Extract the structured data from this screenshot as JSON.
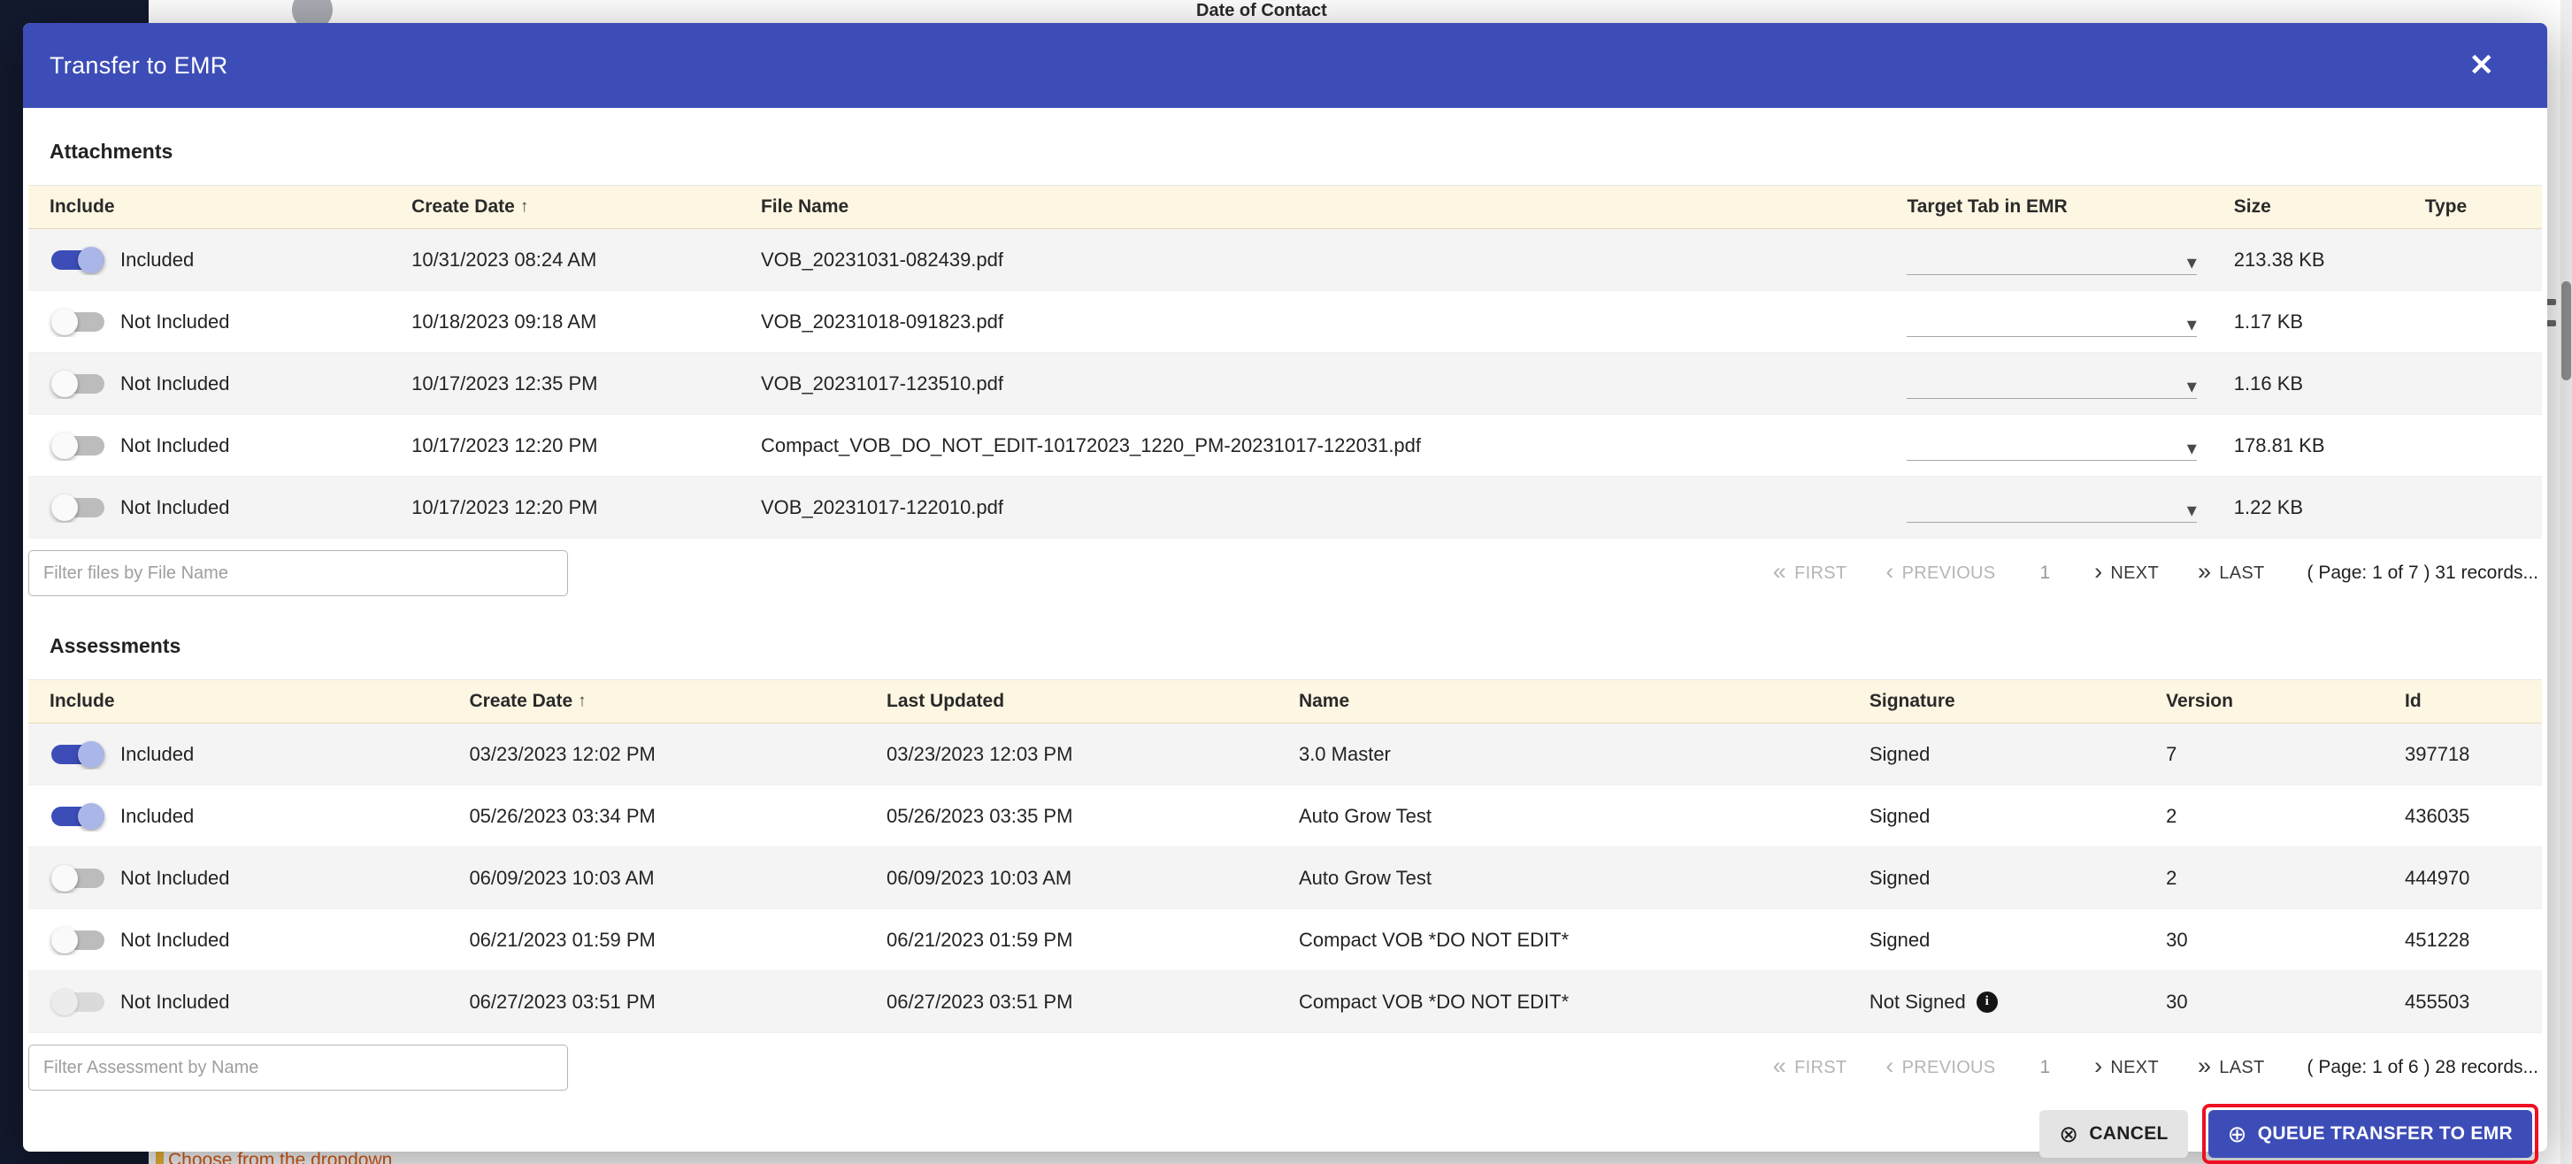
{
  "colors": {
    "accent": "#3d4db7",
    "table-header-bg": "#fdf6e2",
    "row-alt": "#f4f4f4",
    "annotation": "#ee1020",
    "hint-orange": "#e05a14",
    "sidebar": "#131a2e"
  },
  "icons": {
    "close": "✕",
    "caret": "▾",
    "info": "i",
    "cancel_circle": "⊗",
    "plus_circle": "⊕"
  },
  "modal": {
    "title": "Transfer to EMR"
  },
  "attachments": {
    "section_label": "Attachments",
    "columns": {
      "include": "Include",
      "create_date": "Create Date",
      "sort_arrow": "↑",
      "file_name": "File Name",
      "target_tab": "Target Tab in EMR",
      "size": "Size",
      "type": "Type"
    },
    "rows": [
      {
        "include_label": "Included",
        "create_date": "10/31/2023 08:24 AM",
        "file_name": "VOB_20231031-082439.pdf",
        "size": "213.38 KB"
      },
      {
        "include_label": "Not Included",
        "create_date": "10/18/2023 09:18 AM",
        "file_name": "VOB_20231018-091823.pdf",
        "size": "1.17 KB"
      },
      {
        "include_label": "Not Included",
        "create_date": "10/17/2023 12:35 PM",
        "file_name": "VOB_20231017-123510.pdf",
        "size": "1.16 KB"
      },
      {
        "include_label": "Not Included",
        "create_date": "10/17/2023 12:20 PM",
        "file_name": "Compact_VOB_DO_NOT_EDIT-10172023_1220_PM-20231017-122031.pdf",
        "size": "178.81 KB"
      },
      {
        "include_label": "Not Included",
        "create_date": "10/17/2023 12:20 PM",
        "file_name": "VOB_20231017-122010.pdf",
        "size": "1.22 KB"
      }
    ],
    "filter_placeholder": "Filter files by File Name",
    "pagination": {
      "first_icon": "«",
      "first": "FIRST",
      "prev_icon": "‹",
      "previous": "PREVIOUS",
      "page": "1",
      "next_icon": "›",
      "next": "NEXT",
      "last_icon": "»",
      "last": "LAST",
      "summary": "( Page: 1 of 7 ) 31 records..."
    }
  },
  "assessments": {
    "section_label": "Assessments",
    "columns": {
      "include": "Include",
      "create_date": "Create Date",
      "sort_arrow": "↑",
      "last_updated": "Last Updated",
      "name": "Name",
      "signature": "Signature",
      "version": "Version",
      "id": "Id"
    },
    "rows": [
      {
        "include_label": "Included",
        "create_date": "03/23/2023 12:02 PM",
        "last_updated": "03/23/2023 12:03 PM",
        "name": "3.0 Master",
        "signature": "Signed",
        "version": "7",
        "id": "397718"
      },
      {
        "include_label": "Included",
        "create_date": "05/26/2023 03:34 PM",
        "last_updated": "05/26/2023 03:35 PM",
        "name": "Auto Grow Test",
        "signature": "Signed",
        "version": "2",
        "id": "436035"
      },
      {
        "include_label": "Not Included",
        "create_date": "06/09/2023 10:03 AM",
        "last_updated": "06/09/2023 10:03 AM",
        "name": "Auto Grow Test",
        "signature": "Signed",
        "version": "2",
        "id": "444970"
      },
      {
        "include_label": "Not Included",
        "create_date": "06/21/2023 01:59 PM",
        "last_updated": "06/21/2023 01:59 PM",
        "name": "Compact VOB *DO NOT EDIT*",
        "signature": "Signed",
        "version": "30",
        "id": "451228"
      },
      {
        "include_label": "Not Included",
        "create_date": "06/27/2023 03:51 PM",
        "last_updated": "06/27/2023 03:51 PM",
        "name": "Compact VOB *DO NOT EDIT*",
        "signature": "Not Signed",
        "version": "30",
        "id": "455503"
      }
    ],
    "filter_placeholder": "Filter Assessment by Name",
    "pagination": {
      "first_icon": "«",
      "first": "FIRST",
      "prev_icon": "‹",
      "previous": "PREVIOUS",
      "page": "1",
      "next_icon": "›",
      "next": "NEXT",
      "last_icon": "»",
      "last": "LAST",
      "summary": "( Page: 1 of 6 ) 28 records..."
    }
  },
  "footer": {
    "cancel_label": "CANCEL",
    "queue_label": "QUEUE TRANSFER TO EMR"
  },
  "background": {
    "top_label": "Date of Contact",
    "bottom_hint": "Choose from the dropdown"
  }
}
